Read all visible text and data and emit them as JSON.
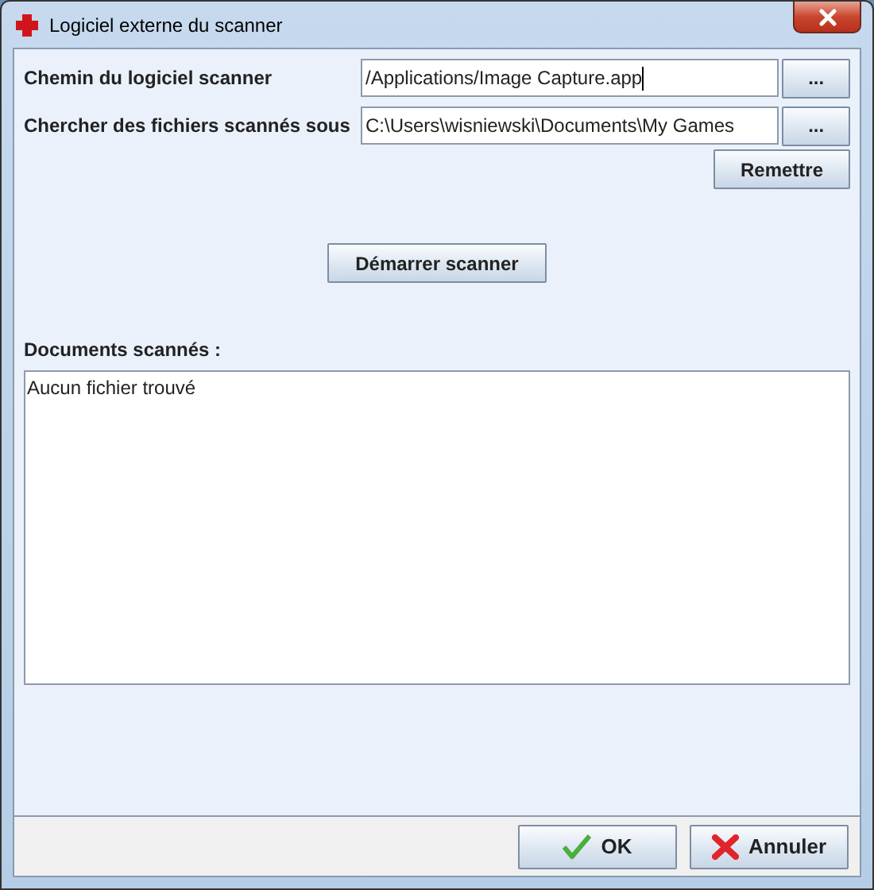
{
  "window": {
    "title": "Logiciel externe du scanner"
  },
  "fields": [
    {
      "label": "Chemin du logiciel scanner",
      "value": "/Applications/Image Capture.app",
      "focused": true,
      "browse": "..."
    },
    {
      "label": "Chercher des fichiers scannés sous",
      "value": "C:\\Users\\wisniewski\\Documents\\My Games",
      "focused": false,
      "browse": "..."
    }
  ],
  "reset_button": "Remettre",
  "scan_button": "Démarrer scanner",
  "documents": {
    "label": "Documents scannés :",
    "content": "Aucun fichier trouvé"
  },
  "buttons": [
    {
      "label": "OK",
      "kind": "ok"
    },
    {
      "label": "Annuler",
      "kind": "cancel"
    }
  ]
}
